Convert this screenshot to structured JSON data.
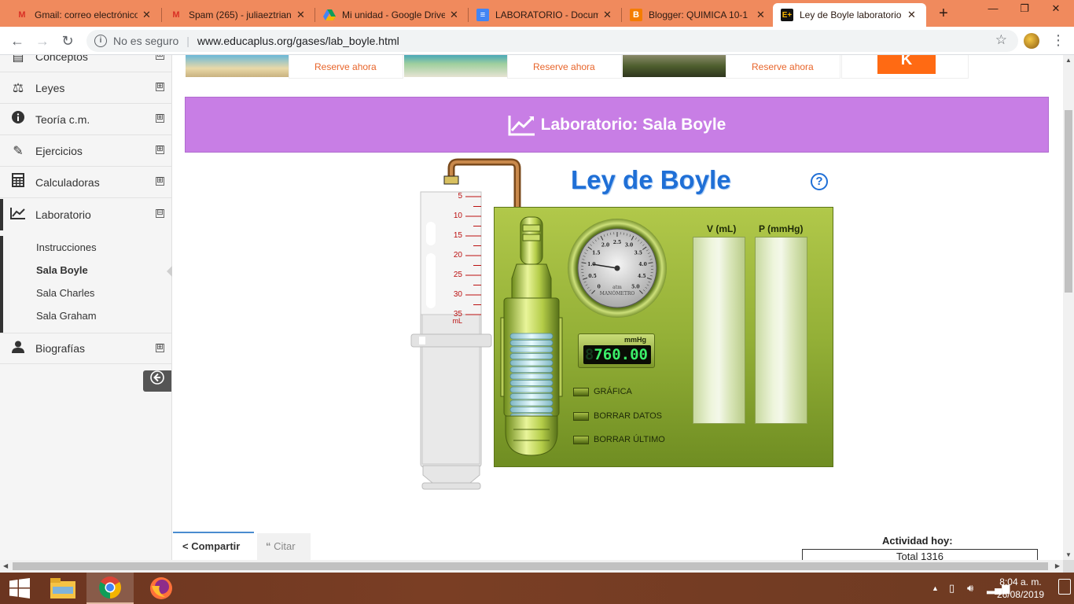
{
  "browser": {
    "tabs": [
      {
        "label": "Gmail: correo electrónico",
        "icon": "gmail-icon",
        "active": false
      },
      {
        "label": "Spam (265) - juliaeztrian",
        "icon": "gmail-icon",
        "active": false
      },
      {
        "label": "Mi unidad - Google Drive",
        "icon": "drive-icon",
        "active": false
      },
      {
        "label": "LABORATORIO - Docum",
        "icon": "docs-icon",
        "active": false
      },
      {
        "label": "Blogger: QUIMICA 10-1",
        "icon": "blogger-icon",
        "active": false
      },
      {
        "label": "Ley de Boyle laboratorio",
        "icon": "educaplus-icon",
        "active": true
      }
    ],
    "address": {
      "security": "No es seguro",
      "url": "www.educaplus.org/gases/lab_boyle.html"
    }
  },
  "sidebar": {
    "items": [
      {
        "label": "Conceptos",
        "icon": "concepts-icon",
        "expander": "⊞"
      },
      {
        "label": "Leyes",
        "icon": "scales-icon",
        "expander": "⊞"
      },
      {
        "label": "Teoría c.m.",
        "icon": "info-icon",
        "expander": "⊞"
      },
      {
        "label": "Ejercicios",
        "icon": "pencil-icon",
        "expander": "⊞"
      },
      {
        "label": "Calculadoras",
        "icon": "calculator-icon",
        "expander": "⊞"
      },
      {
        "label": "Laboratorio",
        "icon": "chart-line-icon",
        "expander": "⊟"
      },
      {
        "label": "Biografías",
        "icon": "user-icon",
        "expander": "⊞"
      }
    ],
    "sub_items": [
      {
        "label": "Instrucciones",
        "current": false
      },
      {
        "label": "Sala Boyle",
        "current": true
      },
      {
        "label": "Sala Charles",
        "current": false
      },
      {
        "label": "Sala Graham",
        "current": false
      }
    ]
  },
  "ads": {
    "links": [
      "Reserve ahora",
      "Reserve ahora",
      "Reserve ahora"
    ],
    "logo_letter": "K"
  },
  "lab": {
    "header_title": "Laboratorio: Sala Boyle",
    "sim_title": "Ley de Boyle",
    "help_symbol": "?",
    "syringe": {
      "scale": [
        "5",
        "10",
        "15",
        "20",
        "25",
        "30",
        "35"
      ],
      "unit": "mL"
    },
    "gauge": {
      "ticks": [
        "0",
        "0.5",
        "1.0",
        "1.5",
        "2.0",
        "2.5",
        "3.0",
        "3.5",
        "4.0",
        "4.5",
        "5.0"
      ],
      "unit": "atm",
      "label": "MANÓMETRO",
      "reading_atm": 1.0
    },
    "digital": {
      "unit": "mmHg",
      "value": "760.00",
      "ghost": "8"
    },
    "columns": [
      {
        "header": "V (mL)"
      },
      {
        "header": "P (mmHg)"
      }
    ],
    "buttons": [
      "GRÁFICA",
      "BORRAR DATOS",
      "BORRAR ÚLTIMO"
    ]
  },
  "footer": {
    "share_label": "Compartir",
    "cite_label": "Citar",
    "activity_label": "Actividad hoy:",
    "activity_total": "Total 1316"
  },
  "taskbar": {
    "time": "8:04 a. m.",
    "date": "26/08/2019"
  },
  "colors": {
    "tabbar": "#f08a5d",
    "header_purple": "#c87ee5",
    "title_blue": "#1f6fd6",
    "panel_green": "#94b037",
    "lcd_green": "#3cf06a",
    "ad_orange": "#e8652b"
  }
}
